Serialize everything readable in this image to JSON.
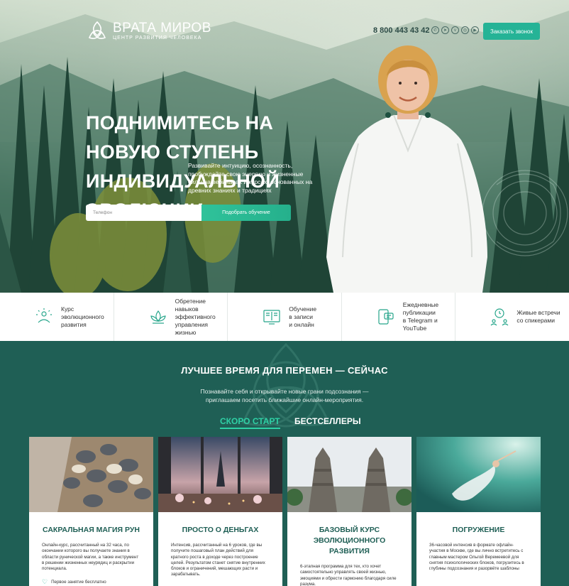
{
  "header": {
    "logo_title": "ВРАТА МИРОВ",
    "logo_subtitle": "ЦЕНТР РАЗВИТИЯ ЧЕЛОВЕКА",
    "phone": "8 800 443 43 42",
    "socials": [
      "whatsapp-icon",
      "telegram-icon",
      "vk-icon",
      "instagram-icon",
      "youtube-icon"
    ],
    "call_button": "Заказать звонок"
  },
  "hero": {
    "title": "ПОДНИМИТЕСЬ НА НОВУЮ СТУПЕНЬ ИНДИВИДУАЛЬНОЙ ЭВОЛЮЦИИ",
    "description": "Развивайте интуицию, осознанность, пробуждайте свою энергию и жизненные силы на вебинарах и курсах, основанных на древних знаниях и традициях",
    "phone_placeholder": "Телефон",
    "submit_label": "Подобрать обучение"
  },
  "features": [
    {
      "icon": "meditation-icon",
      "text": "Курс\nэволюционного\nразвития"
    },
    {
      "icon": "lotus-icon",
      "text": "Обретение навыков\nэффективного\nуправления жизнью"
    },
    {
      "icon": "book-icon",
      "text": "Обучение\nв записи\nи онлайн"
    },
    {
      "icon": "chat-icon",
      "text": "Ежедневные\nпубликации\nв Telegram и YouTube"
    },
    {
      "icon": "speakers-icon",
      "text": "Живые встречи\nсо спикерами"
    }
  ],
  "section": {
    "title": "ЛУЧШЕЕ ВРЕМЯ ДЛЯ ПЕРЕМЕН — СЕЙЧАС",
    "subtitle": "Познавайте себя и открывайте новые грани подсознания — приглашаем посетить ближайшие онлайн-мероприятия.",
    "tabs": [
      "СКОРО СТАРТ",
      "БЕСТСЕЛЛЕРЫ"
    ]
  },
  "cards": [
    {
      "title": "САКРАЛЬНАЯ МАГИЯ РУН",
      "text": "Онлайн-курс, рассчитанный на 32 часа, по окончании которого вы получаете знания в области рунической магии, а также инструмент в решении жизненных неурядиц и раскрытии потенциала.",
      "footer": "Первое занятие бесплатно"
    },
    {
      "title": "ПРОСТО О ДЕНЬГАХ",
      "text": "Интенсив, рассчитанный на 6 уроков, где вы получите пошаговый план действий для кратного роста в доходе через построение целей. Результатом станет снятие внутренних блоков и ограничений, мешающих расти и зарабатывать."
    },
    {
      "title": "БАЗОВЫЙ КУРС ЭВОЛЮЦИОННОГО РАЗВИТИЯ",
      "text": "6-этапная программа для тех, кто хочет самостоятельно управлять своей жизнью, эмоциями и обрести гармонию благодаря силе разума."
    },
    {
      "title": "ПОГРУЖЕНИЕ",
      "text": "36-часовой интенсив в формате офлайн-участия в Москве, где вы лично встретитесь с главным мастером Ольгой Веремеевой для снятия психологических блоков, погрузитесь в глубины подсознания и разорвёте шаблоны"
    }
  ]
}
